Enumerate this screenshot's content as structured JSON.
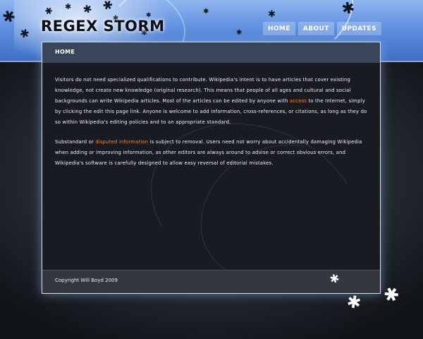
{
  "site": {
    "title": "REGEX STORM"
  },
  "nav": [
    {
      "label": "HOME"
    },
    {
      "label": "ABOUT"
    },
    {
      "label": "UPDATES"
    }
  ],
  "breadcrumb": "HOME",
  "content": {
    "p1": {
      "before": "Visitors do not need specialized qualifications to contribute. Wikipedia's intent is to have articles that cover existing knowledge, not create new knowledge (original research). This means that people of all ages and cultural and social backgrounds can write Wikipedia articles. Most of the articles can be edited by anyone with ",
      "link": "access",
      "after": " to the Internet, simply by clicking the edit this page link. Anyone is welcome to add information, cross-references, or citations, as long as they do so within Wikipedia's editing policies and to an appropriate standard."
    },
    "p2": {
      "before": "Substandard or ",
      "link": "disputed information",
      "after": " is subject to removal. Users need not worry about accidentally damaging Wikipedia when adding or improving information, as other editors are always around to advise or correct obvious errors, and Wikipedia's software is carefully designed to allow easy reversal of editorial mistakes."
    }
  },
  "footer": {
    "copyright": "Copyright Will Boyd 2009"
  },
  "colors": {
    "header_blue": "#5f8fde",
    "link_orange": "#ff8c1a",
    "panel_bg": "#181b21",
    "footer_bg": "#34373d"
  },
  "icons": [
    "maple-leaf-icon"
  ]
}
